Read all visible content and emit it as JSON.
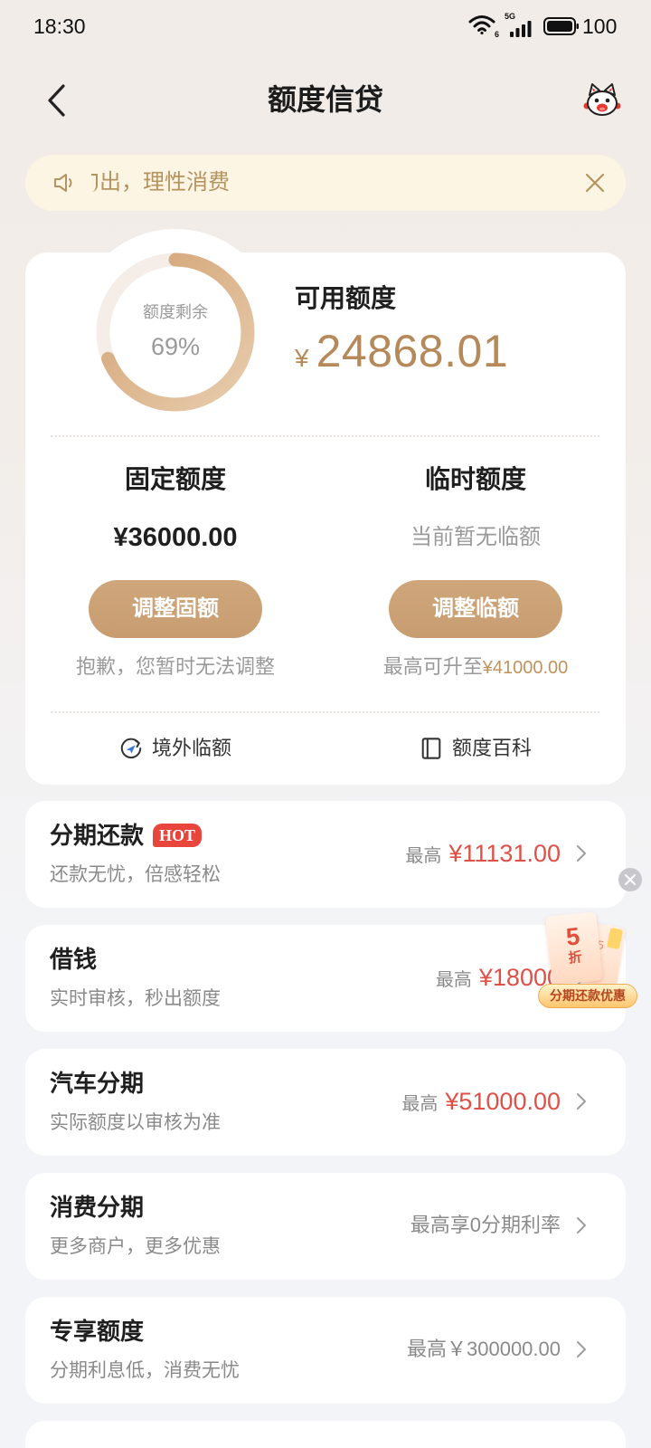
{
  "status_bar": {
    "time": "18:30",
    "wifi_icon": "wifi-icon",
    "wifi_badge": "6",
    "signal_icon": "cellular-signal-icon",
    "network": "5G",
    "battery_icon": "battery-icon",
    "battery": "100"
  },
  "header": {
    "back_icon": "chevron-left-icon",
    "title": "额度信贷",
    "assistant_icon": "mascot-assistant-icon"
  },
  "notice": {
    "icon": "speaker-icon",
    "text": "出，理性消费",
    "close_icon": "close-icon"
  },
  "quota": {
    "remaining_label": "额度剩余",
    "remaining_percent": "69%",
    "remaining_fraction": 0.69,
    "available_label": "可用额度",
    "currency": "¥",
    "available_amount": "24868.01",
    "fixed": {
      "label": "固定额度",
      "value": "¥36000.00",
      "button": "调整固额",
      "note": "抱歉，您暂时无法调整"
    },
    "temporary": {
      "label": "临时额度",
      "value": "当前暂无临额",
      "button": "调整临额",
      "note_prefix": "最高可升至",
      "note_amount": "¥41000.00"
    },
    "links": [
      {
        "icon": "overseas-quota-icon",
        "label": "境外临额"
      },
      {
        "icon": "book-icon",
        "label": "额度百科"
      }
    ]
  },
  "services": [
    {
      "title": "分期还款",
      "badge": "HOT",
      "subtitle": "还款无忧，倍感轻松",
      "max_label": "最高",
      "max_amount": "¥11131.00",
      "icon": "chevron-right-icon"
    },
    {
      "title": "借钱",
      "subtitle": "实时审核，秒出额度",
      "max_label": "最高",
      "max_amount": "¥18000",
      "icon": "chevron-right-icon"
    },
    {
      "title": "汽车分期",
      "subtitle": "实际额度以审核为准",
      "max_label": "最高",
      "max_amount": "¥51000.00",
      "icon": "chevron-right-icon"
    },
    {
      "title": "消费分期",
      "subtitle": "更多商户，更多优惠",
      "note": "最高享0分期利率",
      "icon": "chevron-right-icon"
    },
    {
      "title": "专享额度",
      "subtitle": "分期利息低，消费无忧",
      "note": "最高￥300000.00",
      "icon": "chevron-right-icon"
    }
  ],
  "promo": {
    "close_icon": "close-circle-icon",
    "discount_number": "5",
    "discount_unit": "折",
    "back_ticket_numbers": [
      "5",
      "7"
    ],
    "label": "分期还款优惠"
  },
  "colors": {
    "accent_tan": "#b6895a",
    "button_tan": "#c79d70",
    "amount_red": "#df5048",
    "hot_badge": "#e8453c",
    "notice_bg": "#fdf5e3",
    "notice_text": "#b4935f"
  }
}
